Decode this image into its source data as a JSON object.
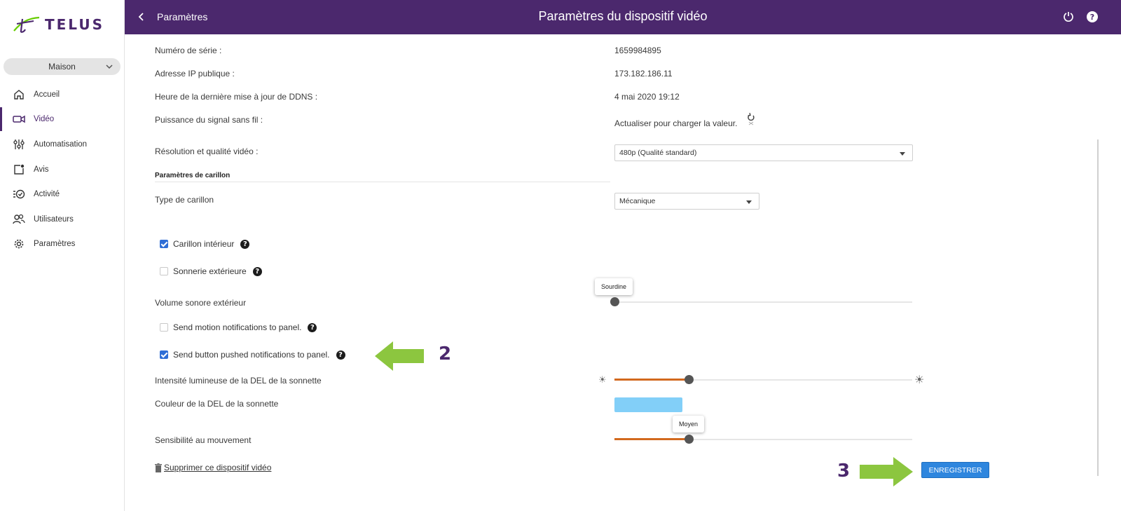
{
  "brand": {
    "name": "TELUS",
    "primary_color": "#4b286d",
    "accent_color": "#2e86de"
  },
  "sidebar": {
    "site_selector": "Maison",
    "items": [
      {
        "label": "Accueil",
        "icon": "home-icon",
        "active": false
      },
      {
        "label": "Vidéo",
        "icon": "video-camera-icon",
        "active": true
      },
      {
        "label": "Automatisation",
        "icon": "sliders-icon",
        "active": false
      },
      {
        "label": "Avis",
        "icon": "notification-icon",
        "active": false
      },
      {
        "label": "Activité",
        "icon": "activity-icon",
        "active": false
      },
      {
        "label": "Utilisateurs",
        "icon": "users-icon",
        "active": false
      },
      {
        "label": "Paramètres",
        "icon": "gear-icon",
        "active": false
      }
    ]
  },
  "header": {
    "breadcrumb": "Paramètres",
    "title": "Paramètres du dispositif vidéo"
  },
  "fields": {
    "serial_label": "Numéro de série :",
    "serial_value": "1659984895",
    "ip_label": "Adresse IP publique :",
    "ip_value": "173.182.186.11",
    "ddns_label": "Heure de la dernière mise à jour de DDNS :",
    "ddns_value": "4 mai 2020 19:12",
    "signal_label": "Puissance du signal sans fil :",
    "signal_value": "Actualiser pour charger la valeur.",
    "resolution_label": "Résolution et qualité vidéo :",
    "resolution_value": "480p (Qualité standard)"
  },
  "chime": {
    "section_title": "Paramètres de carillon",
    "type_label": "Type de carillon",
    "type_value": "Mécanique",
    "interior_label": "Carillon intérieur",
    "interior_checked": true,
    "exterior_label": "Sonnerie extérieure",
    "exterior_checked": false,
    "volume_label": "Volume sonore extérieur",
    "volume_tooltip": "Sourdine",
    "volume_level": 0
  },
  "notifications": {
    "motion_label": "Send motion notifications to panel.",
    "motion_checked": false,
    "button_label": "Send button pushed notifications to panel.",
    "button_checked": true
  },
  "led": {
    "intensity_label": "Intensité lumineuse de la DEL de la sonnette",
    "intensity_level": 0.25,
    "color_label": "Couleur de la DEL de la sonnette",
    "color_value": "#82cff8"
  },
  "motion": {
    "sensitivity_label": "Sensibilité au mouvement",
    "sensitivity_tooltip": "Moyen",
    "sensitivity_level": 0.25
  },
  "actions": {
    "delete_label": "Supprimer ce dispositif vidéo",
    "save_label": "ENREGISTRER"
  },
  "annotations": {
    "step2": "2",
    "step3": "3",
    "arrow_color": "#8cc63f"
  }
}
